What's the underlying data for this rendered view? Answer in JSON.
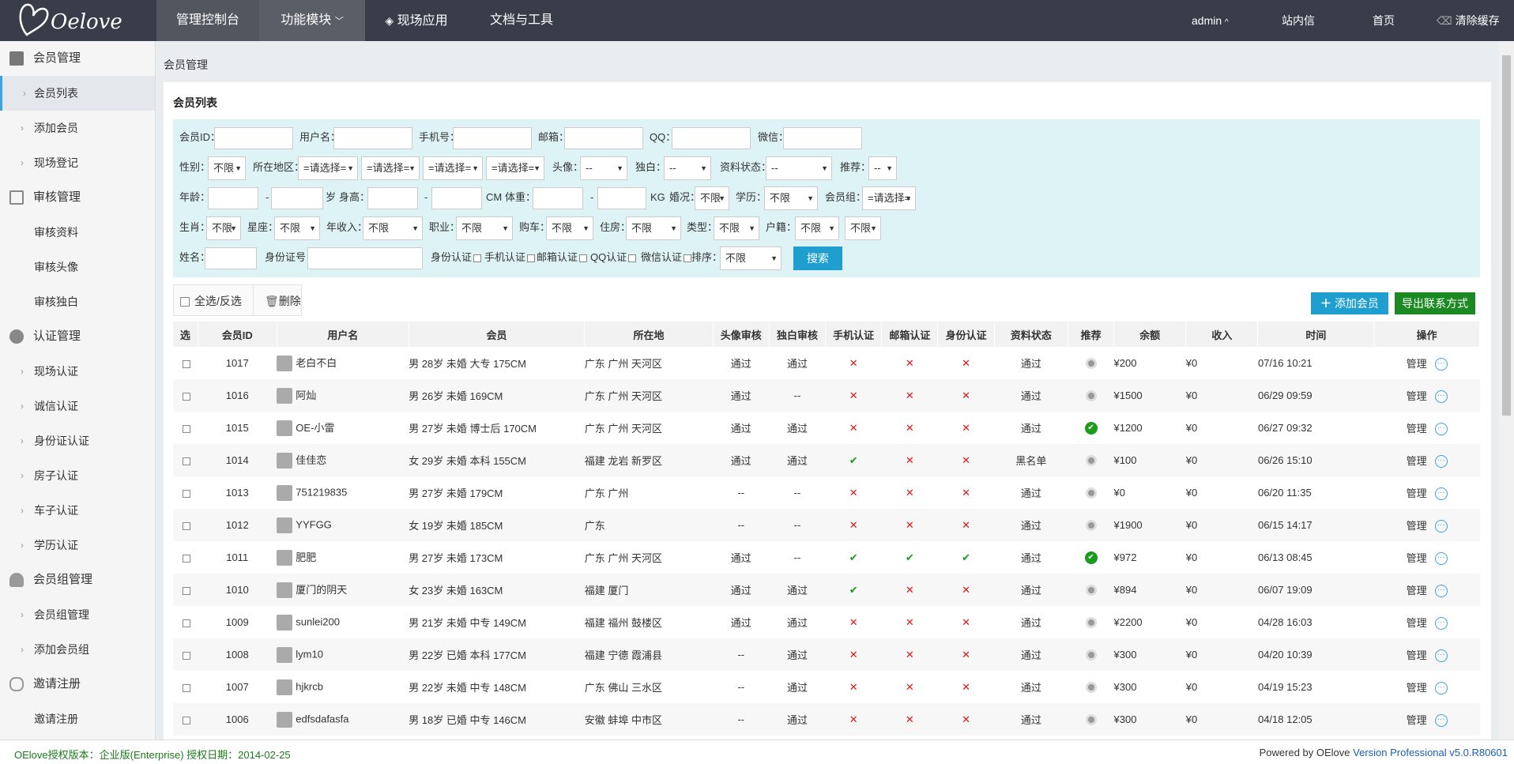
{
  "header": {
    "logo_text": "Oelove",
    "nav": [
      "管理控制台",
      "功能模块",
      "现场应用",
      "文档与工具"
    ],
    "user": "admin",
    "right_links": [
      "站内信",
      "首页",
      "清除缓存"
    ]
  },
  "sidebar": {
    "groups": [
      {
        "label": "会员管理",
        "items": [
          "会员列表",
          "添加会员",
          "现场登记"
        ]
      },
      {
        "label": "审核管理",
        "items": [
          "审核资料",
          "审核头像",
          "审核独白"
        ]
      },
      {
        "label": "认证管理",
        "items": [
          "现场认证",
          "诚信认证",
          "身份证认证",
          "房子认证",
          "车子认证",
          "学历认证"
        ]
      },
      {
        "label": "会员组管理",
        "items": [
          "会员组管理",
          "添加会员组"
        ]
      },
      {
        "label": "邀请注册",
        "items": [
          "邀请注册"
        ]
      }
    ]
  },
  "breadcrumb": "会员管理",
  "panel_title": "会员列表",
  "filters": {
    "row1": {
      "member_id": "会员ID：",
      "username": "用户名：",
      "phone": "手机号：",
      "email": "邮箱：",
      "qq": "QQ：",
      "wechat": "微信："
    },
    "row2": {
      "gender": "性别：",
      "gender_val": "不限",
      "region": "所在地区：",
      "region_sel": "=请选择=",
      "avatar": "头像：",
      "avatar_val": "--",
      "monologue": "独白：",
      "monologue_val": "--",
      "profile_status": "资料状态：",
      "profile_val": "--",
      "recommend": "推荐：",
      "recommend_val": "--"
    },
    "row3": {
      "age": "年龄：",
      "dash": "-",
      "sui": "岁",
      "height": "身高：",
      "cm": "CM",
      "weight": "体重：",
      "kg": "KG",
      "marriage": "婚况：",
      "marriage_val": "不限",
      "education": "学历：",
      "education_val": "不限",
      "group": "会员组：",
      "group_val": "=请选择="
    },
    "row4": {
      "zodiac": "生肖：",
      "zodiac_val": "不限",
      "star": "星座：",
      "star_val": "不限",
      "income": "年收入：",
      "income_val": "不限",
      "job": "职业：",
      "job_val": "不限",
      "car": "购车：",
      "car_val": "不限",
      "house": "住房：",
      "house_val": "不限",
      "type": "类型：",
      "type_val": "不限",
      "hukou": "户籍：",
      "hukou_val": "不限",
      "extra_val": "不限"
    },
    "row5": {
      "name": "姓名：",
      "idcard": "身份证号：",
      "id_auth": "身份认证",
      "phone_auth": "手机认证",
      "email_auth": "邮箱认证",
      "qq_auth": "QQ认证",
      "wechat_auth": "微信认证",
      "sort": "排序：",
      "sort_val": "不限",
      "search": "搜索"
    }
  },
  "toolbar": {
    "select_all": "全选/反选",
    "delete": "删除",
    "add_member": "添加会员",
    "export": "导出联系方式"
  },
  "columns": [
    "选",
    "会员ID",
    "用户名",
    "会员",
    "所在地",
    "头像审核",
    "独白审核",
    "手机认证",
    "邮箱认证",
    "身份认证",
    "资料状态",
    "推荐",
    "余额",
    "收入",
    "时间",
    "操作"
  ],
  "rows": [
    {
      "id": "1017",
      "user": "老白不白",
      "member": "男 28岁 未婚 大专 175CM",
      "loc": "广东 广州 天河区",
      "avatar": "通过",
      "mono": "通过",
      "phone": "x",
      "email": "x",
      "idc": "x",
      "status": "通过",
      "reco": "off",
      "balance": "¥200",
      "income": "¥0",
      "time": "07/16 10:21"
    },
    {
      "id": "1016",
      "user": "阿灿",
      "member": "男 26岁 未婚 169CM",
      "loc": "广东 广州 天河区",
      "avatar": "通过",
      "mono": "--",
      "phone": "x",
      "email": "x",
      "idc": "x",
      "status": "通过",
      "reco": "off",
      "balance": "¥1500",
      "income": "¥0",
      "time": "06/29 09:59"
    },
    {
      "id": "1015",
      "user": "OE-小雷",
      "member": "男 27岁 未婚 博士后 170CM",
      "loc": "广东 广州 天河区",
      "avatar": "通过",
      "mono": "通过",
      "phone": "x",
      "email": "x",
      "idc": "x",
      "status": "通过",
      "reco": "on",
      "balance": "¥1200",
      "income": "¥0",
      "time": "06/27 09:32"
    },
    {
      "id": "1014",
      "user": "佳佳恋",
      "member": "女 29岁 未婚 本科 155CM",
      "loc": "福建 龙岩 新罗区",
      "avatar": "通过",
      "mono": "通过",
      "phone": "v",
      "email": "x",
      "idc": "x",
      "status": "黑名单",
      "reco": "off",
      "balance": "¥100",
      "income": "¥0",
      "time": "06/26 15:10"
    },
    {
      "id": "1013",
      "user": "751219835",
      "member": "男 27岁 未婚 179CM",
      "loc": "广东 广州",
      "avatar": "--",
      "mono": "--",
      "phone": "x",
      "email": "x",
      "idc": "x",
      "status": "通过",
      "reco": "off",
      "balance": "¥0",
      "income": "¥0",
      "time": "06/20 11:35"
    },
    {
      "id": "1012",
      "user": "YYFGG",
      "member": "女 19岁 未婚 185CM",
      "loc": "广东",
      "avatar": "--",
      "mono": "--",
      "phone": "x",
      "email": "x",
      "idc": "x",
      "status": "通过",
      "reco": "off",
      "balance": "¥1900",
      "income": "¥0",
      "time": "06/15 14:17"
    },
    {
      "id": "1011",
      "user": "肥肥",
      "member": "男 27岁 未婚 173CM",
      "loc": "广东 广州 天河区",
      "avatar": "通过",
      "mono": "--",
      "phone": "v",
      "email": "v",
      "idc": "v",
      "status": "通过",
      "reco": "on",
      "balance": "¥972",
      "income": "¥0",
      "time": "06/13 08:45"
    },
    {
      "id": "1010",
      "user": "厦门的阴天",
      "member": "女 23岁 未婚 163CM",
      "loc": "福建 厦门",
      "avatar": "通过",
      "mono": "通过",
      "phone": "v",
      "email": "x",
      "idc": "x",
      "status": "通过",
      "reco": "off",
      "balance": "¥894",
      "income": "¥0",
      "time": "06/07 19:09"
    },
    {
      "id": "1009",
      "user": "sunlei200",
      "member": "男 21岁 未婚 中专 149CM",
      "loc": "福建 福州 鼓楼区",
      "avatar": "通过",
      "mono": "通过",
      "phone": "x",
      "email": "x",
      "idc": "x",
      "status": "通过",
      "reco": "off",
      "balance": "¥2200",
      "income": "¥0",
      "time": "04/28 16:03"
    },
    {
      "id": "1008",
      "user": "lym10",
      "member": "男 22岁 已婚 本科 177CM",
      "loc": "福建 宁德 霞浦县",
      "avatar": "--",
      "mono": "通过",
      "phone": "x",
      "email": "x",
      "idc": "x",
      "status": "通过",
      "reco": "off",
      "balance": "¥300",
      "income": "¥0",
      "time": "04/20 10:39"
    },
    {
      "id": "1007",
      "user": "hjkrcb",
      "member": "男 22岁 未婚 中专 148CM",
      "loc": "广东 佛山 三水区",
      "avatar": "--",
      "mono": "通过",
      "phone": "x",
      "email": "x",
      "idc": "x",
      "status": "通过",
      "reco": "off",
      "balance": "¥300",
      "income": "¥0",
      "time": "04/19 15:23"
    },
    {
      "id": "1006",
      "user": "edfsdafasfa",
      "member": "男 18岁 已婚 中专 146CM",
      "loc": "安徽 蚌埠 中市区",
      "avatar": "--",
      "mono": "通过",
      "phone": "x",
      "email": "x",
      "idc": "x",
      "status": "通过",
      "reco": "off",
      "balance": "¥300",
      "income": "¥0",
      "time": "04/18 12:05"
    }
  ],
  "row_action": "管理",
  "footer": {
    "left": "OElove授权版本：企业版(Enterprise) 授权日期：2014-02-25",
    "right_prefix": "Powered by OElove",
    "right_version": "Version Professional v5.0.R80601"
  },
  "colors": {
    "topbar": "#393d49",
    "accent": "#1e9fcf",
    "green": "#1a9b1a",
    "red": "#e01616"
  }
}
